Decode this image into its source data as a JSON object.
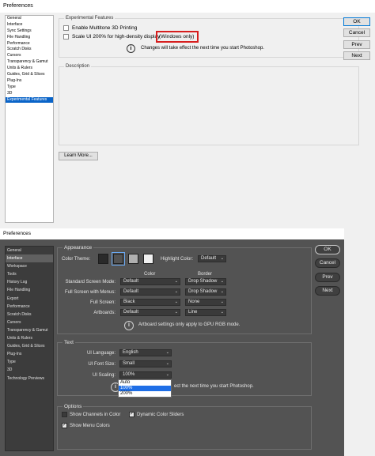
{
  "light": {
    "title": "Preferences",
    "sidebar": [
      "General",
      "Interface",
      "Sync Settings",
      "File Handling",
      "Performance",
      "Scratch Disks",
      "Cursors",
      "Transparency & Gamut",
      "Units & Rulers",
      "Guides, Grid & Slices",
      "Plug-Ins",
      "Type",
      "3D",
      "Experimental Features"
    ],
    "selected_index": 13,
    "experimental": {
      "title": "Experimental Features",
      "opt1": "Enable Multitone 3D Printing",
      "opt2": "Scale UI 200% for high-density display",
      "highlight": "(Windows only)",
      "note": "Changes will take effect the next time you start Photoshop."
    },
    "description_title": "Description",
    "learn_more": "Learn More...",
    "buttons": {
      "ok": "OK",
      "cancel": "Cancel",
      "prev": "Prev",
      "next": "Next"
    }
  },
  "dark": {
    "title": "Preferences",
    "sidebar": [
      "General",
      "Interface",
      "Workspace",
      "Tools",
      "History Log",
      "File Handling",
      "Export",
      "Performance",
      "Scratch Disks",
      "Cursors",
      "Transparency & Gamut",
      "Units & Rulers",
      "Guides, Grid & Slices",
      "Plug-Ins",
      "Type",
      "3D",
      "Technology Previews"
    ],
    "selected_index": 1,
    "appearance": {
      "title": "Appearance",
      "color_theme_label": "Color Theme:",
      "theme_swatches": [
        "#2a2a2a",
        "#525252",
        "#b0b0b0",
        "#f0f0f0"
      ],
      "highlight_label": "Highlight Color:",
      "highlight_value": "Default",
      "col_color": "Color",
      "col_border": "Border",
      "rows": [
        {
          "label": "Standard Screen Mode:",
          "color": "Default",
          "border": "Drop Shadow"
        },
        {
          "label": "Full Screen with Menus:",
          "color": "Default",
          "border": "Drop Shadow"
        },
        {
          "label": "Full Screen:",
          "color": "Black",
          "border": "None"
        },
        {
          "label": "Artboards:",
          "color": "Default",
          "border": "Line"
        }
      ],
      "note": "Artboard settings only apply to GPU RGB mode."
    },
    "text": {
      "title": "Text",
      "language_label": "UI Language:",
      "language_value": "English",
      "font_label": "UI Font Size:",
      "font_value": "Small",
      "scaling_label": "UI Scaling:",
      "scaling_value": "100%",
      "scaling_options": [
        "Auto",
        "100%",
        "200%"
      ],
      "scaling_highlighted": 1,
      "note": "ect the next time you start Photoshop."
    },
    "options": {
      "title": "Options",
      "show_channels": "Show Channels in Color",
      "dynamic_sliders": "Dynamic Color Sliders",
      "show_menu_colors": "Show Menu Colors"
    },
    "buttons": {
      "ok": "OK",
      "cancel": "Cancel",
      "prev": "Prev",
      "next": "Next"
    }
  }
}
